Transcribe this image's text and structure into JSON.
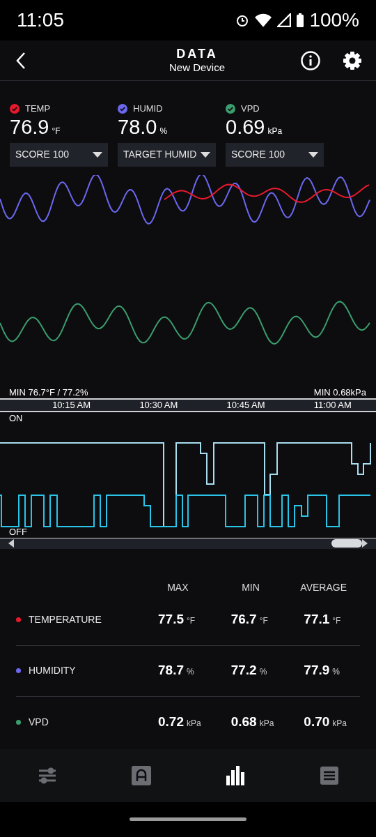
{
  "status_bar": {
    "time": "11:05",
    "battery": "100%"
  },
  "header": {
    "title": "DATA",
    "subtitle": "New Device"
  },
  "metrics": [
    {
      "label": "TEMP",
      "value": "76.9",
      "unit": "°F",
      "checked": true,
      "color": "#e8192c",
      "dropdown": "SCORE 100"
    },
    {
      "label": "HUMID",
      "value": "78.0",
      "unit": "%",
      "checked": true,
      "color": "#6b68f0",
      "dropdown": "TARGET HUMID"
    },
    {
      "label": "VPD",
      "value": "0.69",
      "unit": "kPa",
      "checked": true,
      "color": "#3b9e6e",
      "dropdown": "SCORE 100"
    }
  ],
  "chart": {
    "min_left": "MIN 76.7°F / 77.2%",
    "min_right": "MIN 0.68kPa",
    "times": [
      "10:15 AM",
      "10:30 AM",
      "10:45 AM",
      "11:00 AM"
    ]
  },
  "onoff": {
    "on_label": "ON",
    "off_label": "OFF"
  },
  "stats": {
    "columns": [
      "MAX",
      "MIN",
      "AVERAGE"
    ],
    "rows": [
      {
        "name": "TEMPERATURE",
        "color": "#e8192c",
        "cells": [
          {
            "value": "77.5",
            "unit": "°F"
          },
          {
            "value": "76.7",
            "unit": "°F"
          },
          {
            "value": "77.1",
            "unit": "°F"
          }
        ]
      },
      {
        "name": "HUMIDITY",
        "color": "#6b68f0",
        "cells": [
          {
            "value": "78.7",
            "unit": "%"
          },
          {
            "value": "77.2",
            "unit": "%"
          },
          {
            "value": "77.9",
            "unit": "%"
          }
        ]
      },
      {
        "name": "VPD",
        "color": "#3b9e6e",
        "cells": [
          {
            "value": "0.72",
            "unit": "kPa"
          },
          {
            "value": "0.68",
            "unit": "kPa"
          },
          {
            "value": "0.70",
            "unit": "kPa"
          }
        ]
      }
    ]
  },
  "bottom_nav": [
    {
      "kind": "sliders",
      "selected": false
    },
    {
      "kind": "device",
      "selected": false
    },
    {
      "kind": "chart",
      "selected": true
    },
    {
      "kind": "list",
      "selected": false
    }
  ]
}
